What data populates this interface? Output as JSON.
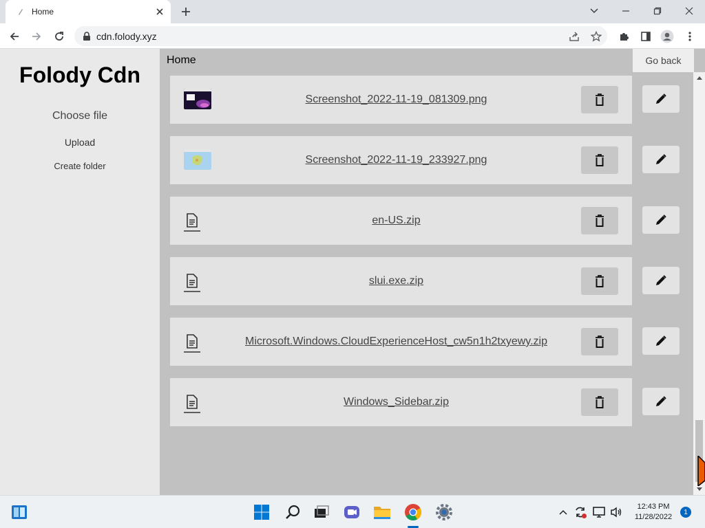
{
  "browser": {
    "tab_title": "Home",
    "url": "cdn.folody.xyz"
  },
  "sidebar": {
    "brand": "Folody Cdn",
    "choose_file": "Choose file",
    "upload": "Upload",
    "create_folder": "Create folder"
  },
  "header": {
    "breadcrumb": "Home",
    "go_back": "Go back"
  },
  "files": [
    {
      "name": "Screenshot_2022-11-19_081309.png",
      "kind": "image-thumbnail"
    },
    {
      "name": "Screenshot_2022-11-19_233927.png",
      "kind": "image-thumbnail"
    },
    {
      "name": "en-US.zip",
      "kind": "file-icon"
    },
    {
      "name": "slui.exe.zip",
      "kind": "file-icon"
    },
    {
      "name": "Microsoft.Windows.CloudExperienceHost_cw5n1h2txyewy.zip",
      "kind": "file-icon"
    },
    {
      "name": "Windows_Sidebar.zip",
      "kind": "file-icon"
    }
  ],
  "taskbar": {
    "time": "12:43 PM",
    "date": "11/28/2022",
    "notification_count": "1"
  },
  "colors": {
    "page_bg": "#c1c1c1",
    "sidebar_bg": "#e9e9e9",
    "row_bg": "#e3e3e3",
    "delete_bg": "#c7c7c7"
  }
}
